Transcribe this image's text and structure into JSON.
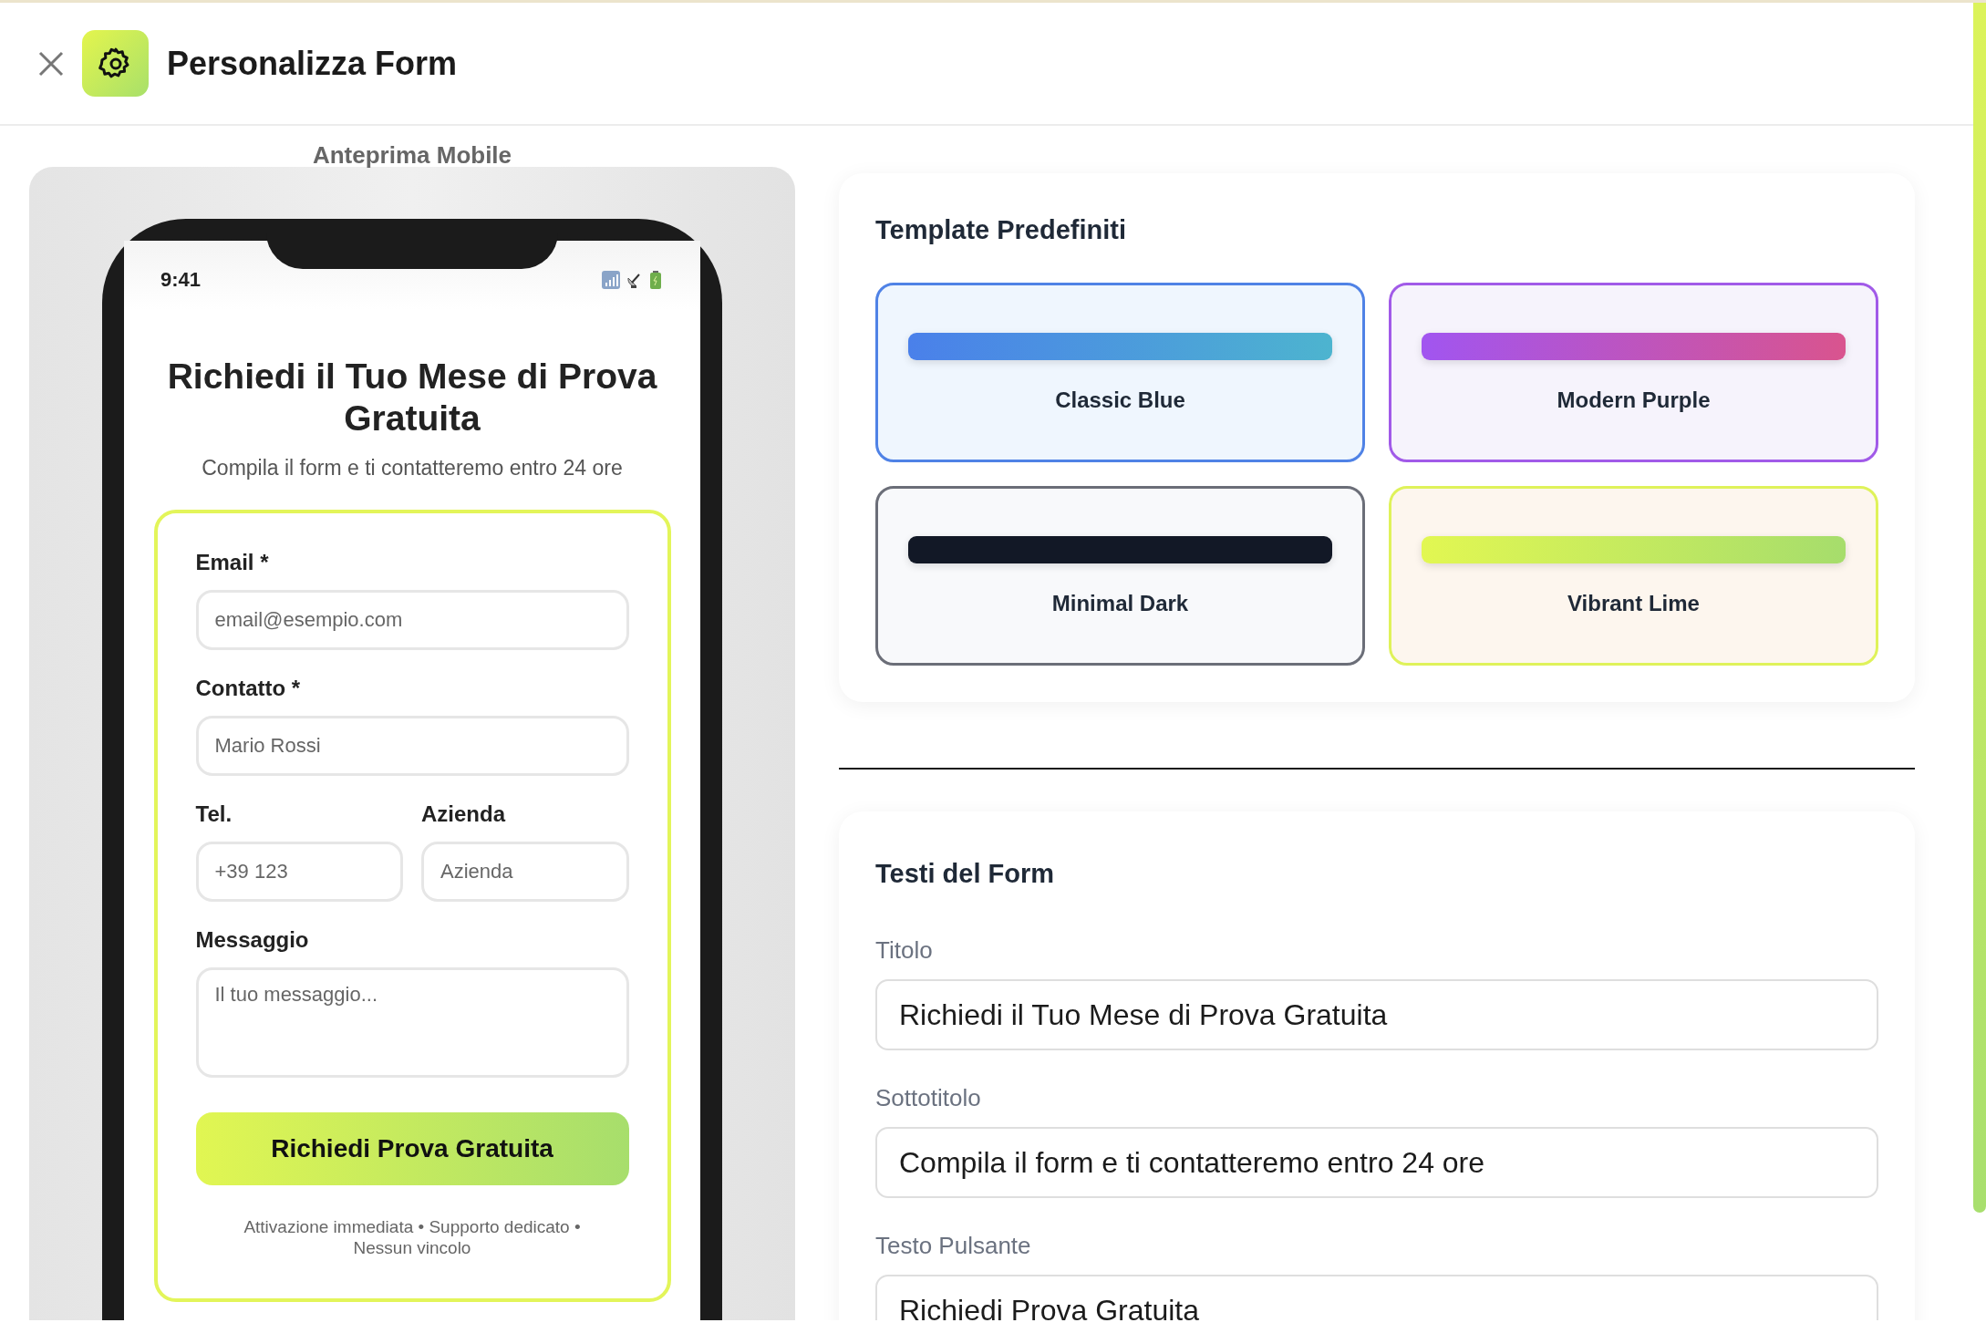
{
  "header": {
    "title": "Personalizza Form"
  },
  "preview": {
    "label": "Anteprima Mobile",
    "status_time": "9:41",
    "form": {
      "title": "Richiedi il Tuo Mese di Prova Gratuita",
      "subtitle": "Compila il form e ti contatteremo entro 24 ore",
      "rows": [
        [
          {
            "label": "Email *",
            "placeholder": "email@esempio.com",
            "kind": "input"
          }
        ],
        [
          {
            "label": "Contatto *",
            "placeholder": "Mario Rossi",
            "kind": "input"
          }
        ],
        [
          {
            "label": "Tel.",
            "placeholder": "+39 123",
            "kind": "input"
          },
          {
            "label": "Azienda",
            "placeholder": "Azienda",
            "kind": "input"
          }
        ],
        [
          {
            "label": "Messaggio",
            "placeholder": "Il tuo messaggio...",
            "kind": "textarea"
          }
        ]
      ],
      "button": "Richiedi Prova Gratuita",
      "footer": "Attivazione immediata • Supporto dedicato • Nessun vincolo"
    }
  },
  "templates": {
    "title": "Template Predefiniti",
    "items": [
      {
        "name": "Classic Blue",
        "color": "#4f82e6",
        "kind": "blue"
      },
      {
        "name": "Modern Purple",
        "color": "#a15ae8",
        "kind": "purple"
      },
      {
        "name": "Minimal Dark",
        "color": "#6b6e78",
        "kind": "dark"
      },
      {
        "name": "Vibrant Lime",
        "color": "#dff25a",
        "kind": "lime"
      }
    ]
  },
  "texts": {
    "title": "Testi del Form",
    "fields": [
      {
        "label": "Titolo",
        "value": "Richiedi il Tuo Mese di Prova Gratuita"
      },
      {
        "label": "Sottotitolo",
        "value": "Compila il form e ti contatteremo entro 24 ore"
      },
      {
        "label": "Testo Pulsante",
        "value": "Richiedi Prova Gratuita"
      }
    ]
  }
}
